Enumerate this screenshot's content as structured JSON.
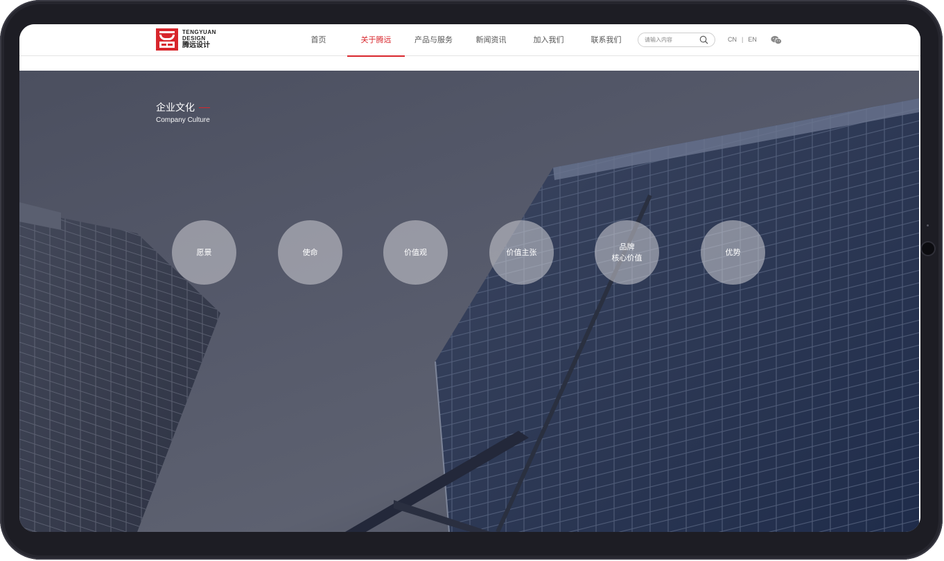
{
  "logo": {
    "en_line1": "TENGYUAN",
    "en_line2": "DESIGN",
    "cn": "腾远设计",
    "brand_color": "#d8262c"
  },
  "nav": {
    "items": [
      {
        "label": "首页",
        "active": false
      },
      {
        "label": "关于腾远",
        "active": true
      },
      {
        "label": "产品与服务",
        "active": false
      },
      {
        "label": "新闻资讯",
        "active": false
      },
      {
        "label": "加入我们",
        "active": false
      },
      {
        "label": "联系我们",
        "active": false
      }
    ]
  },
  "search": {
    "placeholder": "请输入内容",
    "icon": "search-icon"
  },
  "lang": {
    "cn": "CN",
    "separator": "|",
    "en": "EN"
  },
  "social": {
    "icon": "wechat-icon"
  },
  "section": {
    "title_cn": "企业文化",
    "title_en": "Company Culture"
  },
  "culture": {
    "items": [
      {
        "label": "愿景"
      },
      {
        "label": "使命"
      },
      {
        "label": "价值观"
      },
      {
        "label": "价值主张"
      },
      {
        "label": "品牌\n核心价值"
      },
      {
        "label": "优势"
      }
    ]
  }
}
